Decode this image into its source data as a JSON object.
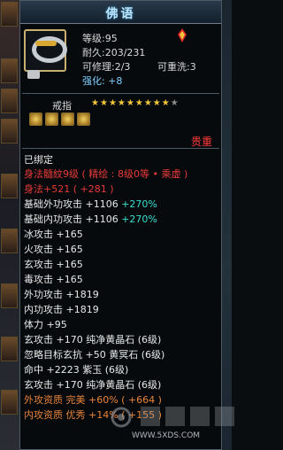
{
  "window": {
    "title": "佛语"
  },
  "item": {
    "level_label": "等级:95",
    "durability_label": "耐久:203/231",
    "repairable_label": "可修理:2/3",
    "rewashable_label": "可重洗:3",
    "enhance_label": "强化: +8"
  },
  "item_type": "戒指",
  "stars": {
    "filled": 9,
    "total": 10
  },
  "rarity": "贵重",
  "bind_status": "已绑定",
  "properties": [
    {
      "text": "身法髓紋9级 ( 精绘 : 8级0等 • 乘虚 )",
      "color": "#e83a3a"
    },
    {
      "text": "身法+521 ( +281 )",
      "color": "#e83a3a"
    },
    {
      "text": "基础外功攻击 +1106 ",
      "extra": "+270%",
      "color": "#e8e8e8",
      "extra_color": "#3ae0d0"
    },
    {
      "text": "基础内功攻击 +1106 ",
      "extra": "+270%",
      "color": "#e8e8e8",
      "extra_color": "#3ae0d0"
    },
    {
      "text": "冰攻击 +165",
      "color": "#e8e8e8"
    },
    {
      "text": "火攻击 +165",
      "color": "#e8e8e8"
    },
    {
      "text": "玄攻击 +165",
      "color": "#e8e8e8"
    },
    {
      "text": "毒攻击 +165",
      "color": "#e8e8e8"
    },
    {
      "text": "外功攻击 +1819",
      "color": "#e8e8e8"
    },
    {
      "text": "内功攻击 +1819",
      "color": "#e8e8e8"
    },
    {
      "text": "体力 +95",
      "color": "#e8e8e8"
    },
    {
      "text": "玄攻击 +170 纯净黄晶石 (6级)",
      "color": "#e8e8e8"
    },
    {
      "text": "忽略目标玄抗 +50 黄冥石 (6级)",
      "color": "#e8e8e8"
    },
    {
      "text": "命中 +2223 紫玉 (6级)",
      "color": "#e8e8e8"
    },
    {
      "text": "玄攻击 +170 纯净黄晶石 (6级)",
      "color": "#e8e8e8"
    },
    {
      "text": "外攻资质  完美 +60% ( +664 )",
      "color": "#e8833a"
    },
    {
      "text": "内攻资质  优秀 +14% ( +155 )",
      "color": "#e8833a"
    }
  ],
  "watermark": {
    "site": "WWW.5XDS.COM"
  }
}
